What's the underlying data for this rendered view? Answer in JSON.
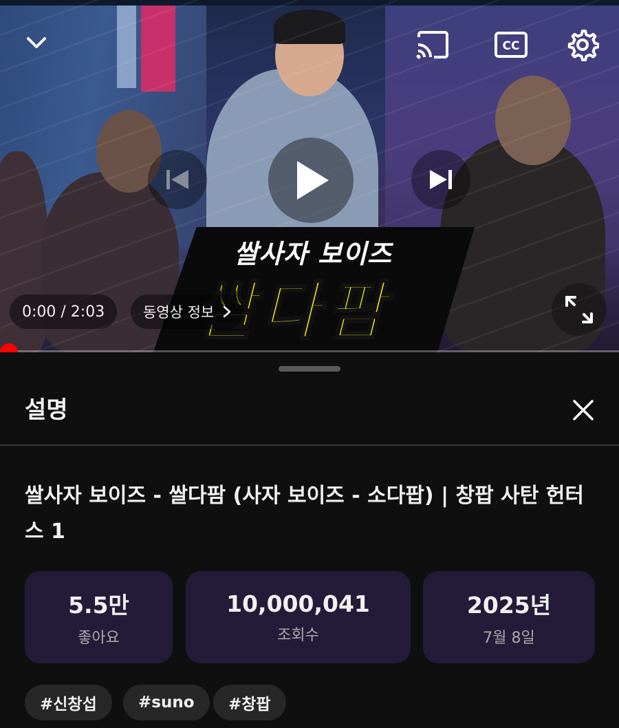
{
  "player": {
    "thumbnail_text_top": "쌀사자 보이즈",
    "thumbnail_text_main": "쌀다팜",
    "time_display": "0:00 / 2:03",
    "info_button_label": "동영상 정보",
    "progress_fraction": 0.0,
    "accent_color": "#ff0000",
    "icons": {
      "collapse": "chevron-down-icon",
      "cast": "cast-icon",
      "captions": "cc-icon",
      "settings": "gear-icon",
      "previous": "skip-previous-icon",
      "play": "play-icon",
      "next": "skip-next-icon",
      "fullscreen": "fullscreen-icon",
      "info_chevron": "chevron-right-icon"
    }
  },
  "description": {
    "header_title": "설명",
    "close_icon": "close-icon",
    "video_title": "쌀사자 보이즈 - 쌀다팜 (사자 보이즈 - 소다팝) | 창팝 사탄 헌터스 1",
    "stats": [
      {
        "value": "5.5만",
        "label": "좋아요"
      },
      {
        "value": "10,000,041",
        "label": "조회수"
      },
      {
        "value": "2025년",
        "label": "7월 8일"
      }
    ],
    "tags": [
      "#신창섭",
      "#suno",
      "#창팝"
    ],
    "card_color": "#231b38",
    "tag_color": "#272727"
  }
}
